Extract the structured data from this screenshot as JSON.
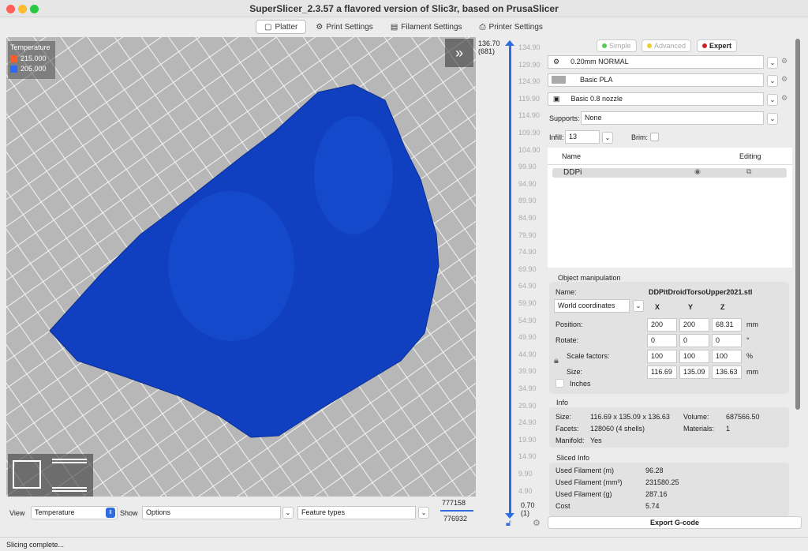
{
  "window": {
    "title": "SuperSlicer_2.3.57 a flavored version of Slic3r, based on PrusaSlicer"
  },
  "tabs": [
    {
      "label": "Platter",
      "icon": "cube-icon"
    },
    {
      "label": "Print Settings",
      "icon": "gear-icon"
    },
    {
      "label": "Filament Settings",
      "icon": "spool-icon"
    },
    {
      "label": "Printer Settings",
      "icon": "printer-icon"
    }
  ],
  "legend": {
    "title": "Temperature",
    "items": [
      {
        "label": "215.000",
        "color": "#ff5a2a"
      },
      {
        "label": "205.000",
        "color": "#2a6aff"
      }
    ]
  },
  "model": {
    "color": "#1040c0"
  },
  "layer_slider": {
    "top_value": "136.70",
    "top_layer": "(681)",
    "bottom_value": "0.70",
    "bottom_layer": "(1)",
    "ticks": [
      "134.90",
      "129.90",
      "124.90",
      "119.90",
      "114.90",
      "109.90",
      "104.90",
      "99.90",
      "94.90",
      "89.90",
      "84.90",
      "79.90",
      "74.90",
      "69.90",
      "64.90",
      "59.90",
      "54.90",
      "49.90",
      "44.90",
      "39.90",
      "34.90",
      "29.90",
      "24.90",
      "19.90",
      "14.90",
      "9.90",
      "4.90"
    ]
  },
  "bottom_bar": {
    "view_label": "View",
    "view_value": "Temperature",
    "show_label": "Show",
    "show_value": "Options",
    "feature_value": "Feature types",
    "move_top": "777158",
    "move_bottom": "776932"
  },
  "modes": {
    "simple": "Simple",
    "advanced": "Advanced",
    "expert": "Expert"
  },
  "presets": {
    "print": "0.20mm NORMAL",
    "filament": "Basic PLA",
    "printer": "Basic 0.8 nozzle"
  },
  "supports": {
    "label": "Supports:",
    "value": "None"
  },
  "infill": {
    "label": "Infill:",
    "value": "13"
  },
  "brim": {
    "label": "Brim:",
    "checked": false
  },
  "object_list": {
    "col_name": "Name",
    "col_editing": "Editing",
    "items": [
      {
        "name": "DDPi"
      }
    ]
  },
  "object_manipulation": {
    "title": "Object manipulation",
    "name_label": "Name:",
    "name_value": "DDPitDroidTorsoUpper2021.stl",
    "coords": "World coordinates",
    "x": "X",
    "y": "Y",
    "z": "Z",
    "rows": [
      {
        "label": "Position:",
        "x": "200",
        "y": "200",
        "z": "68.31",
        "unit": "mm"
      },
      {
        "label": "Rotate:",
        "x": "0",
        "y": "0",
        "z": "0",
        "unit": "°"
      },
      {
        "label": "Scale factors:",
        "x": "100",
        "y": "100",
        "z": "100",
        "unit": "%"
      },
      {
        "label": "Size:",
        "x": "116.69",
        "y": "135.09",
        "z": "136.63",
        "unit": "mm"
      }
    ],
    "inches": "Inches"
  },
  "info": {
    "title": "Info",
    "size_label": "Size:",
    "size": "116.69 x 135.09 x 136.63",
    "volume_label": "Volume:",
    "volume": "687566.50",
    "facets_label": "Facets:",
    "facets": "128060 (4 shells)",
    "materials_label": "Materials:",
    "materials": "1",
    "manifold_label": "Manifold:",
    "manifold": "Yes"
  },
  "sliced_info": {
    "title": "Sliced Info",
    "rows": [
      {
        "label": "Used Filament (m)",
        "value": "96.28"
      },
      {
        "label": "Used Filament (mm³)",
        "value": "231580.25"
      },
      {
        "label": "Used Filament (g)",
        "value": "287.16"
      },
      {
        "label": "Cost",
        "value": "5.74"
      }
    ]
  },
  "export": "Export G-code",
  "status": "Slicing complete..."
}
